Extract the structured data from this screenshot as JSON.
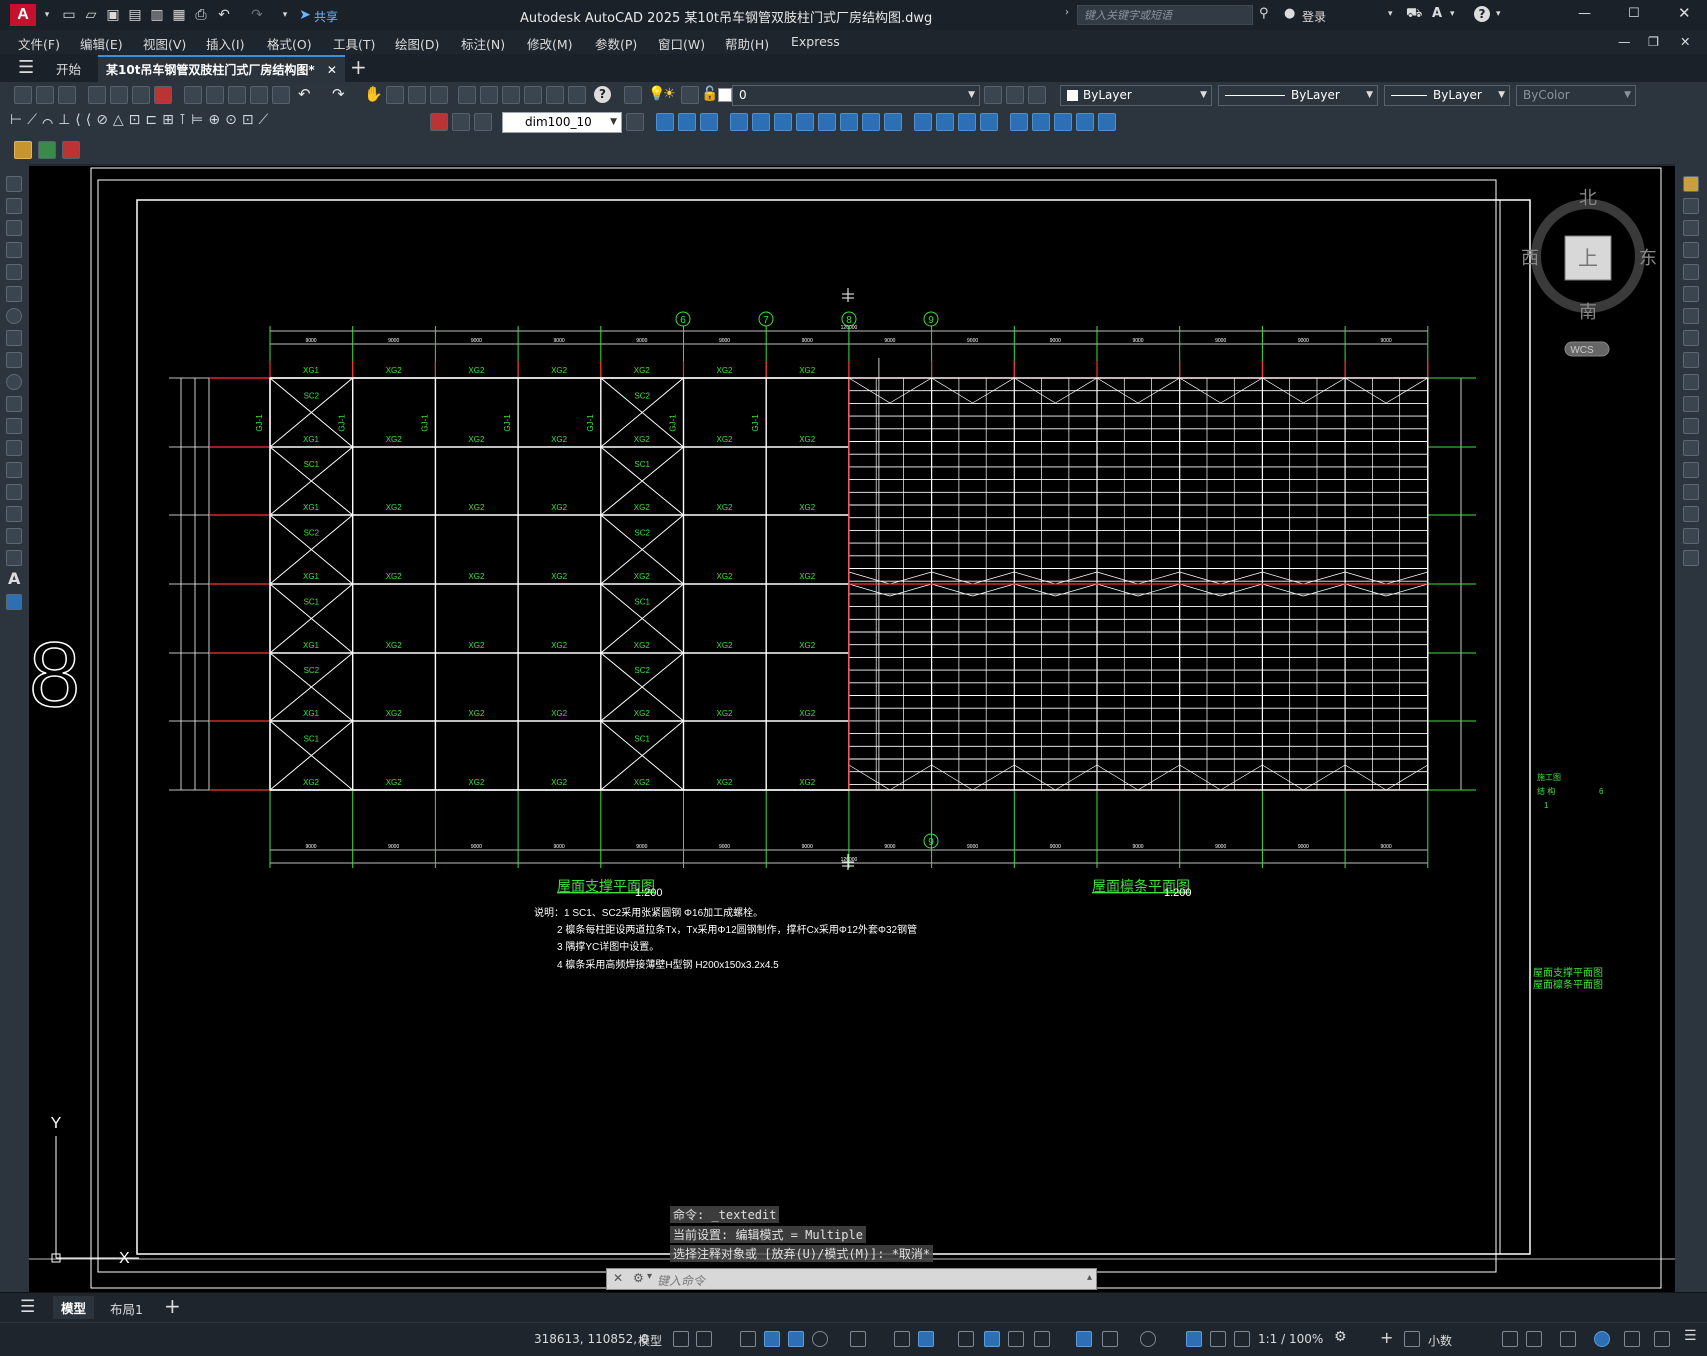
{
  "title_bar": {
    "app_letter": "A",
    "title": "Autodesk AutoCAD 2025    某10t吊车钢管双肢柱门式厂房结构图.dwg",
    "share_label": "共享",
    "search_placeholder": "键入关键字或短语",
    "login_label": "登录"
  },
  "menu": {
    "items": [
      "文件(F)",
      "编辑(E)",
      "视图(V)",
      "插入(I)",
      "格式(O)",
      "工具(T)",
      "绘图(D)",
      "标注(N)",
      "修改(M)",
      "参数(P)",
      "窗口(W)",
      "帮助(H)",
      "Express"
    ]
  },
  "tabs": {
    "start": "开始",
    "document": "某10t吊车钢管双肢柱门式厂房结构图*"
  },
  "toolbar": {
    "layer_value": "0",
    "color_value": "ByLayer",
    "linetype_value": "ByLayer",
    "lineweight_value": "ByLayer",
    "plotstyle_value": "ByColor",
    "dimstyle_value": "dim100_10"
  },
  "viewcube": {
    "north": "北",
    "south": "南",
    "east": "东",
    "west": "西",
    "top": "上",
    "wcs": "WCS"
  },
  "drawing": {
    "grid_numbers_top": [
      "6",
      "7",
      "8",
      "9"
    ],
    "grid_number_bottom": "9",
    "title_left": "屋面支撑平面图",
    "scale_left": "1:200",
    "title_right": "屋面檩条平面图",
    "scale_right": "1:200",
    "notes": [
      "说明：1  SC1、SC2采用张紧圆钢 Φ16加工成螺栓。",
      "2  檩条每柱距设两道拉条Tx，Tx采用Φ12圆钢制作，撑杆Cx采用Φ12外套Φ32钢管",
      "3  隅撑YC详图中设置。",
      "4  檩条采用高频焊接薄壁H型钢 H200x150x3.2x4.5"
    ],
    "dim_small": "9000",
    "total_dim": "126000",
    "member_labels": [
      "XG1",
      "XG2",
      "SC1",
      "SC2",
      "GJ-1"
    ],
    "titleblock": [
      "施工图",
      "结 构",
      "6",
      "1"
    ],
    "titleblock_name": [
      "屋面支撑平面图",
      "屋面檩条平面图"
    ],
    "left_big_digit": "8",
    "ucs_y": "Y",
    "ucs_x": "X"
  },
  "command": {
    "history": [
      "命令: _textedit",
      "当前设置: 编辑模式 = Multiple",
      "选择注释对象或 [放弃(U)/模式(M)]: *取消*"
    ],
    "placeholder": "键入命令"
  },
  "layout_tabs": {
    "model": "模型",
    "layout1": "布局1"
  },
  "status": {
    "coords": "318613, 110852, 0",
    "space": "模型",
    "scale": "1:1 / 100%",
    "units": "小数"
  }
}
